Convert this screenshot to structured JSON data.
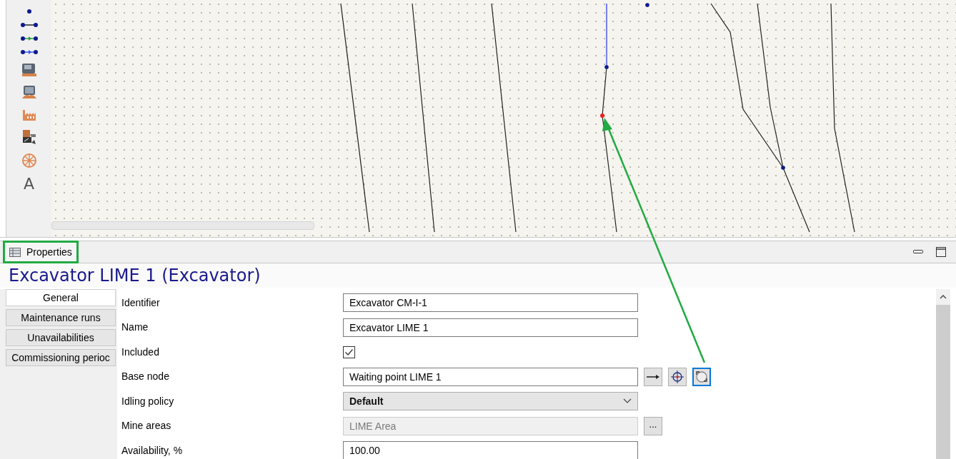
{
  "toolbar": {
    "tools": [
      {
        "kind": "node"
      },
      {
        "kind": "link"
      },
      {
        "kind": "green-link"
      },
      {
        "kind": "blue-link"
      },
      {
        "kind": "loader"
      },
      {
        "kind": "dump"
      },
      {
        "kind": "plant"
      },
      {
        "kind": "crusher"
      },
      {
        "kind": "wheel"
      },
      {
        "kind": "text",
        "label": "A"
      }
    ]
  },
  "properties": {
    "title": "Properties",
    "heading": "Excavator LIME 1 (Excavator)",
    "tabs": [
      {
        "label": "General",
        "selected": true
      },
      {
        "label": "Maintenance runs",
        "selected": false
      },
      {
        "label": "Unavailabilities",
        "selected": false
      },
      {
        "label": "Commissioning perioc",
        "selected": false
      }
    ],
    "fields": [
      {
        "kind": "text",
        "label": "Identifier",
        "value": "Excavator CM-I-1",
        "disabled": false
      },
      {
        "kind": "text",
        "label": "Name",
        "value": "Excavator LIME 1",
        "disabled": false
      },
      {
        "kind": "checkbox",
        "label": "Included",
        "checked": true
      },
      {
        "kind": "text",
        "label": "Base node",
        "value": "Waiting point LIME 1",
        "disabled": false,
        "buttons": [
          {
            "kind": "arrow",
            "focused": false
          },
          {
            "kind": "locate",
            "focused": false
          },
          {
            "kind": "zoom",
            "focused": true
          }
        ]
      },
      {
        "kind": "dropdown",
        "label": "Idling policy",
        "value": "Default"
      },
      {
        "kind": "text",
        "label": "Mine areas",
        "value": "LIME Area",
        "disabled": true,
        "buttons": [
          {
            "kind": "more",
            "label": "...",
            "focused": false
          }
        ]
      },
      {
        "kind": "text",
        "label": "Availability, %",
        "value": "100.00",
        "disabled": false
      }
    ]
  }
}
